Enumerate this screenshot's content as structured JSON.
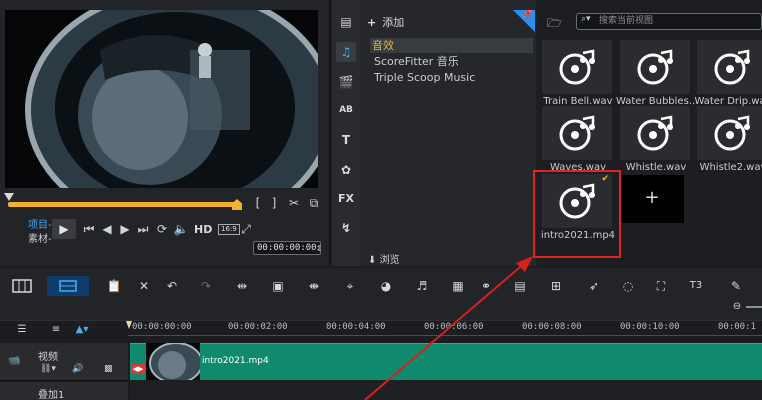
{
  "player": {
    "mode_project": "项目-",
    "mode_clip": "素材-",
    "hd_label": "HD",
    "ratio": "16:9",
    "timecode": "00:00:00:00"
  },
  "library": {
    "add_label": "添加",
    "items": [
      "音效",
      "ScoreFitter 音乐",
      "Triple Scoop Music"
    ],
    "browse_label": "浏览",
    "search_placeholder": "搜索当前视图",
    "thumbnails": [
      {
        "caption": "Train Bell.wav"
      },
      {
        "caption": "Water Bubbles..."
      },
      {
        "caption": "Water Drip.wav"
      },
      {
        "caption": "Waves.wav"
      },
      {
        "caption": "Whistle.wav"
      },
      {
        "caption": "Whistle2.wav"
      },
      {
        "caption": "intro2021.mp4"
      }
    ],
    "add_tile": "+",
    "tool_fx": "FX",
    "tool_ab": "AB",
    "tool_t": "T"
  },
  "timeline": {
    "ticks": [
      "00:00:00:00",
      "00:00:02:00",
      "00:00:04:00",
      "00:00:06:00",
      "00:00:08:00",
      "00:00:10:00",
      "00:00:1"
    ],
    "tracks": [
      {
        "name": "视频"
      },
      {
        "name": "叠加1"
      }
    ],
    "clip_name": "intro2021.mp4"
  },
  "colors": {
    "accent_blue": "#2b8ff0",
    "scrub_orange": "#f1b12a",
    "clip_green": "#0f8a6d",
    "highlight_red": "#e52222"
  }
}
